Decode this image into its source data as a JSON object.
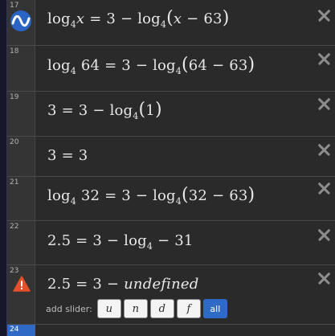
{
  "rows": [
    {
      "number": "17",
      "icon": "desmos-logo-icon",
      "parts": [
        "log",
        "4",
        "x",
        " = 3 − ",
        "log",
        "4",
        "(",
        "x",
        " − 63",
        ")"
      ]
    },
    {
      "number": "18",
      "parts": [
        "log",
        "4",
        " 64 = 3 − ",
        "log",
        "4",
        "(",
        "64 − 63",
        ")"
      ]
    },
    {
      "number": "19",
      "parts": [
        "3 = 3 − ",
        "log",
        "4",
        "(",
        "1",
        ")"
      ]
    },
    {
      "number": "20",
      "parts": [
        "3 = 3"
      ]
    },
    {
      "number": "21",
      "parts": [
        "log",
        "4",
        " 32 = 3 − ",
        "log",
        "4",
        "(",
        "32 − 63",
        ")"
      ]
    },
    {
      "number": "22",
      "parts": [
        "2.5 = 3 − ",
        "log",
        "4",
        " − 31"
      ]
    },
    {
      "number": "23",
      "icon": "warning-icon",
      "parts": [
        "2.5 = 3 − ",
        "undefined"
      ],
      "slider": {
        "label": "add slider:",
        "options": [
          "u",
          "n",
          "d",
          "f"
        ],
        "all_label": "all"
      }
    },
    {
      "number": "24",
      "parts": []
    }
  ],
  "colors": {
    "logo": "#2a64c5",
    "warning": "#e4502b",
    "accent": "#2f6ac7"
  }
}
